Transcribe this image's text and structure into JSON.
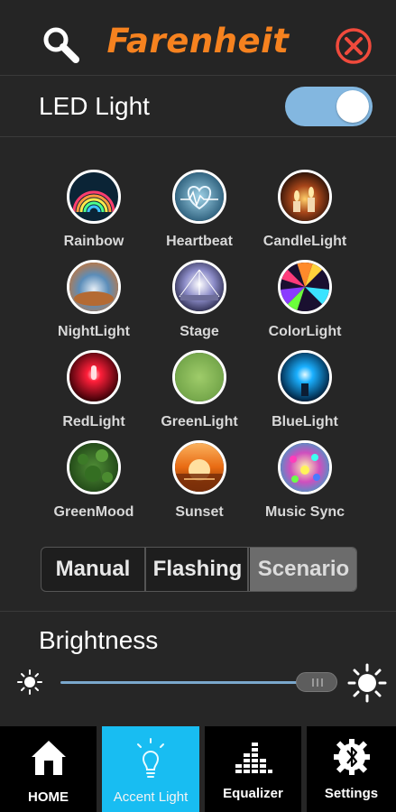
{
  "header": {
    "brand": "Farenheit",
    "search_icon": "search-icon",
    "close_icon": "close-icon",
    "brand_color": "#f6821f"
  },
  "led": {
    "label": "LED Light",
    "enabled": true,
    "toggle_color": "#83b7e0"
  },
  "scenes": [
    {
      "label": "Rainbow"
    },
    {
      "label": "Heartbeat"
    },
    {
      "label": "CandleLight"
    },
    {
      "label": "NightLight"
    },
    {
      "label": "Stage"
    },
    {
      "label": "ColorLight"
    },
    {
      "label": "RedLight"
    },
    {
      "label": "GreenLight"
    },
    {
      "label": "BlueLight"
    },
    {
      "label": "GreenMood"
    },
    {
      "label": "Sunset"
    },
    {
      "label": "Music Sync"
    }
  ],
  "modes": {
    "items": [
      "Manual",
      "Flashing",
      "Scenario"
    ],
    "selected": "Scenario"
  },
  "brightness": {
    "label": "Brightness",
    "level_fraction": 0.92,
    "track_color": "#7aa7cc"
  },
  "nav": {
    "items": [
      {
        "label": "HOME",
        "icon": "home-icon"
      },
      {
        "label": "Accent Light",
        "icon": "bulb-icon"
      },
      {
        "label": "Equalizer",
        "icon": "equalizer-icon"
      },
      {
        "label": "Settings",
        "icon": "bluetooth-gear-icon"
      }
    ],
    "active": "Accent Light",
    "active_color": "#18bdf2"
  }
}
